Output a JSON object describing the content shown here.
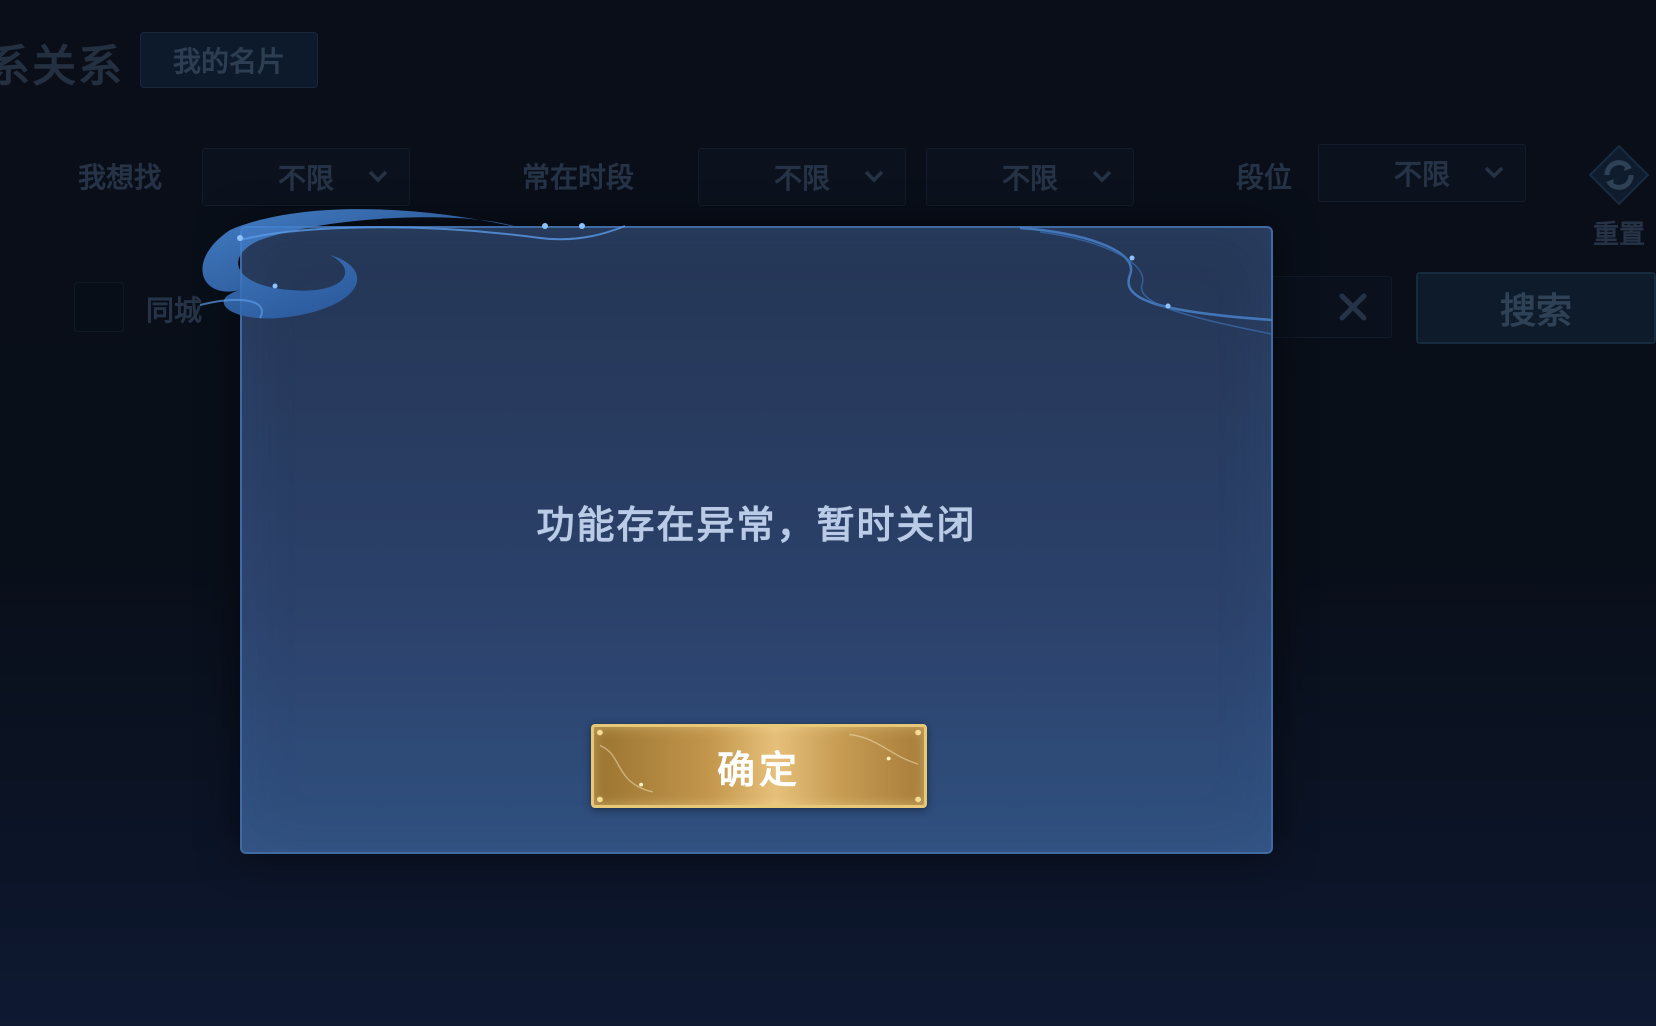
{
  "background": {
    "page_title": "系关系",
    "tab_my_card": "我的名片",
    "filters": {
      "want_label": "我想找",
      "want_value": "不限",
      "time_label": "常在时段",
      "time_value_1": "不限",
      "time_value_2": "不限",
      "rank_label": "段位",
      "rank_value": "不限"
    },
    "reset_label": "重置",
    "same_city_label": "同城",
    "search_button": "搜索"
  },
  "modal": {
    "message": "功能存在异常，暂时关闭",
    "confirm_button": "确定"
  },
  "colors": {
    "modal_border": "#3f6aa3",
    "button_gold": "#e6c07a",
    "message_text": "#b9cbe6"
  }
}
